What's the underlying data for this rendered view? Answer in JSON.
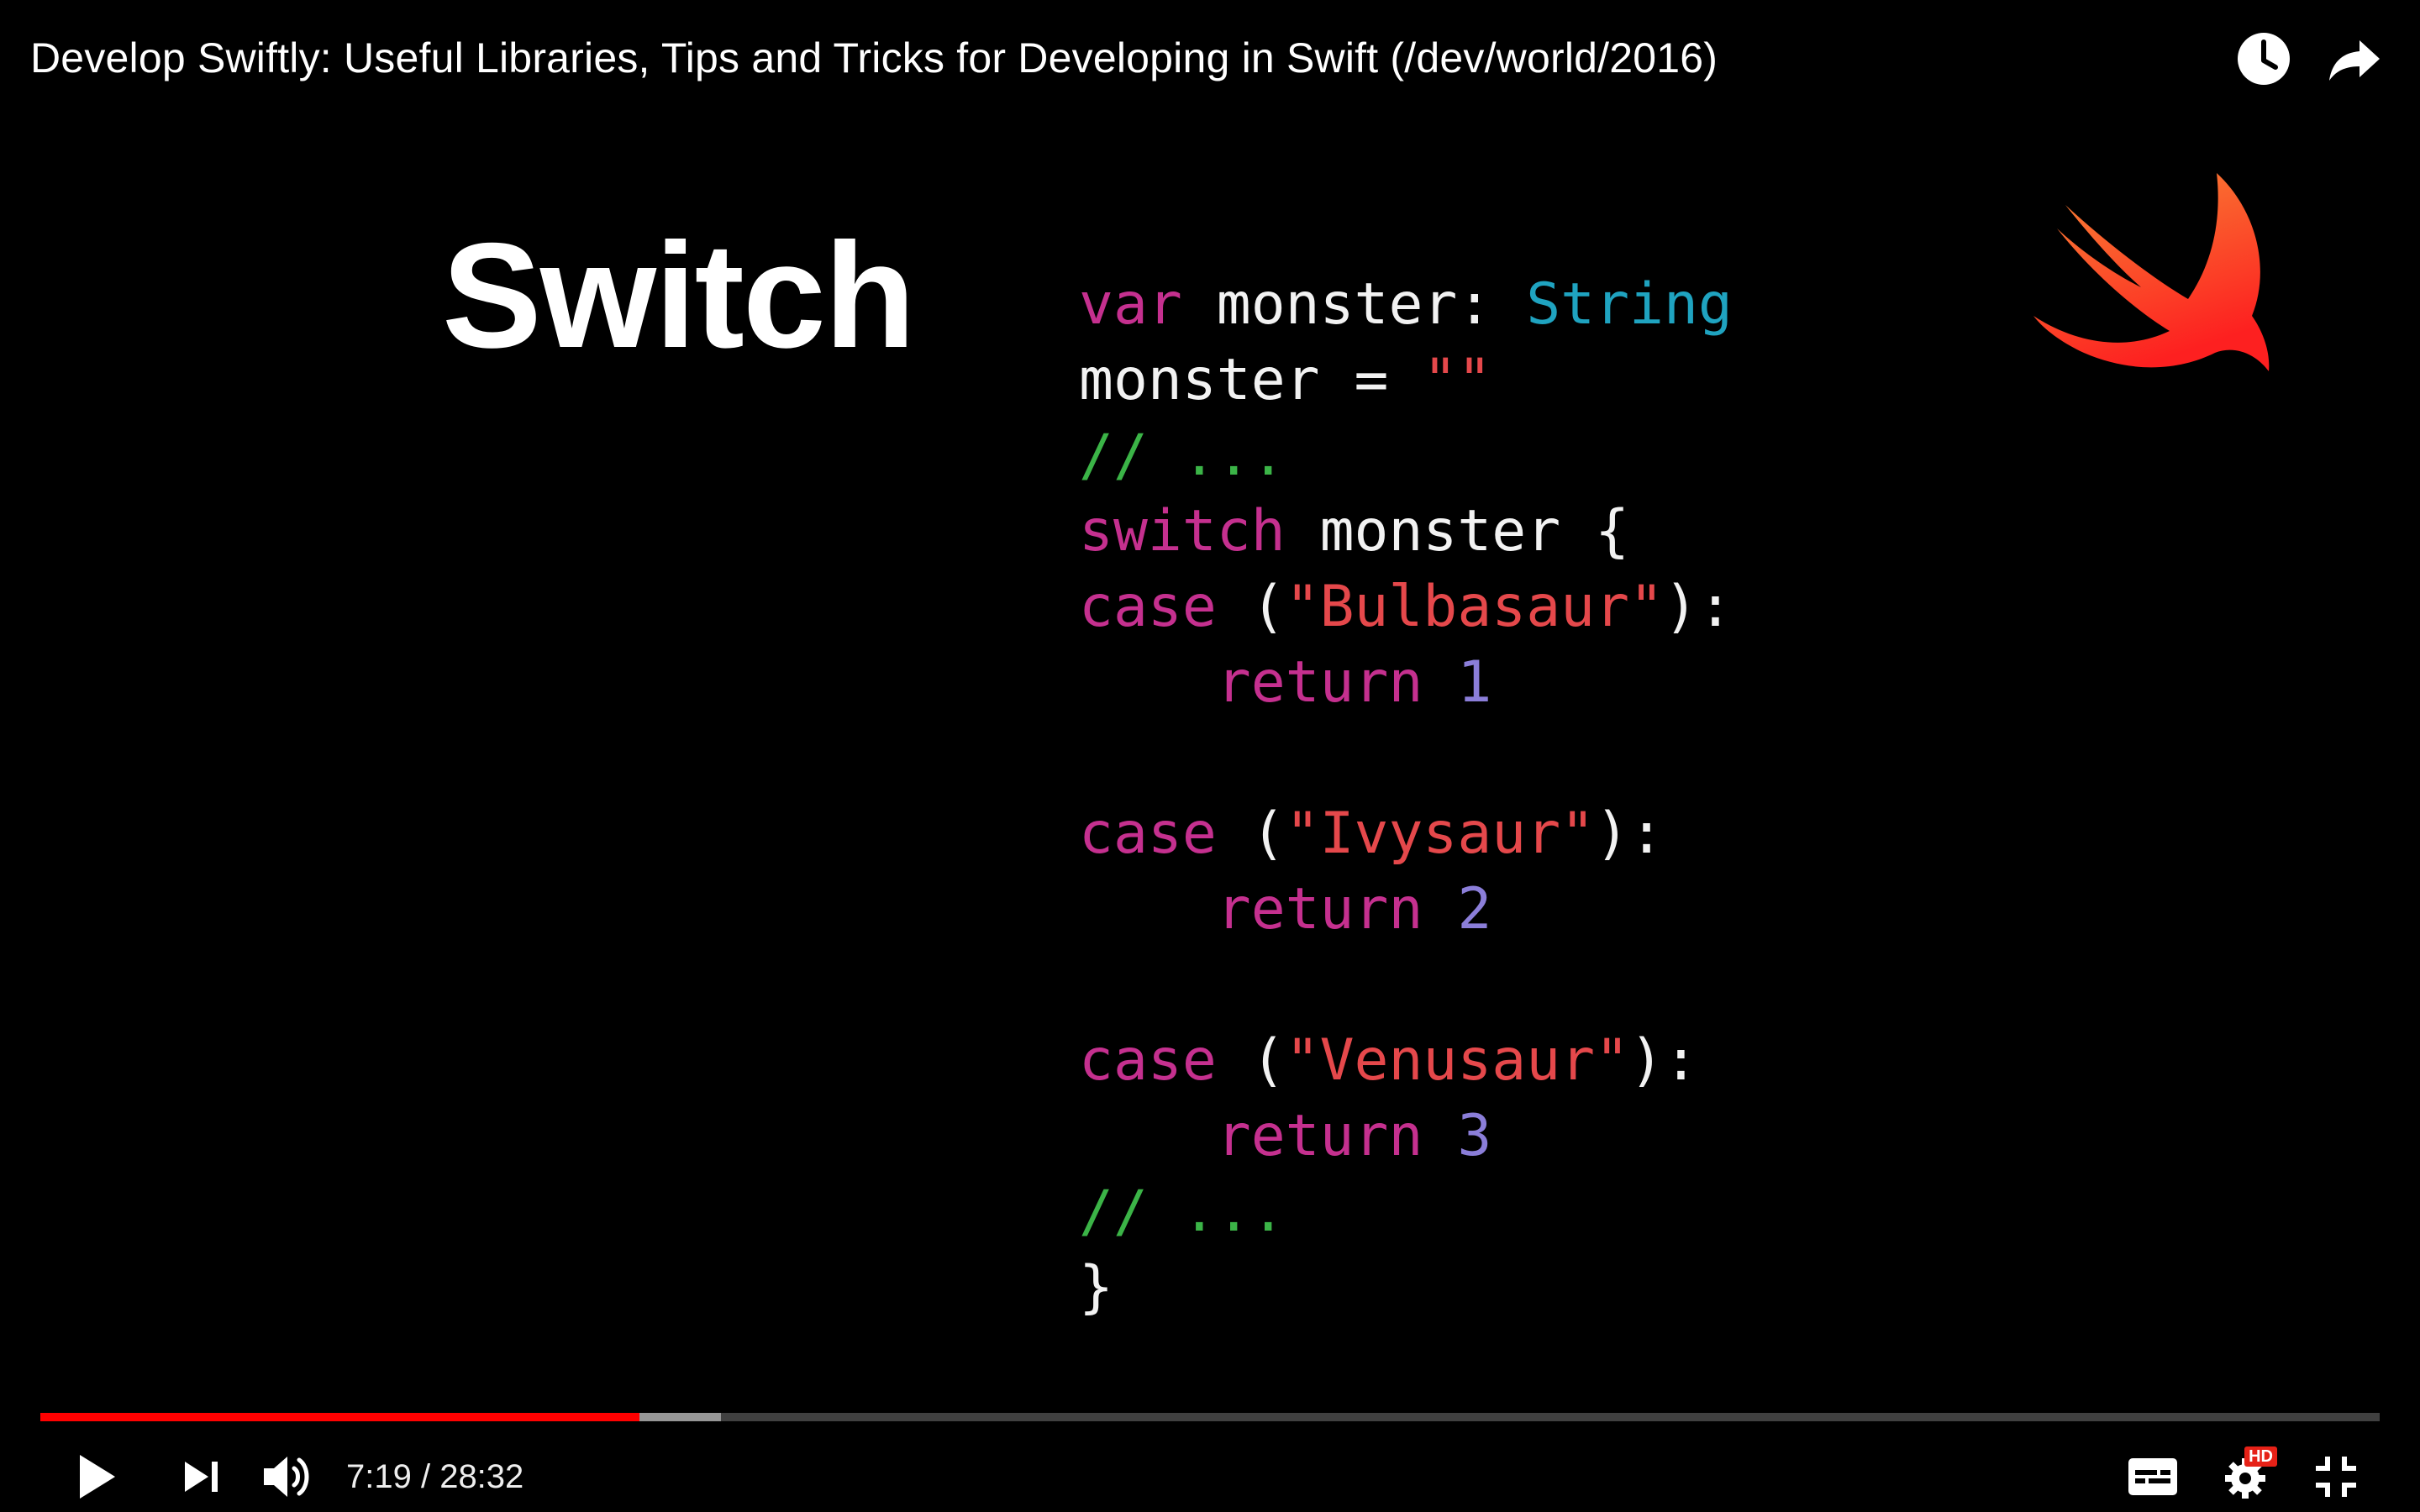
{
  "video": {
    "title": "Develop Swiftly: Useful Libraries, Tips and Tricks for Developing in Swift (/dev/world/2016)",
    "top_icons": [
      "watch-later-icon",
      "share-icon"
    ]
  },
  "slide": {
    "heading": "Switch",
    "logo": "swift-logo",
    "code_lines": [
      [
        {
          "t": "var",
          "c": "kw"
        },
        {
          "t": " monster: ",
          "c": "plain"
        },
        {
          "t": "String",
          "c": "type"
        }
      ],
      [
        {
          "t": "monster = ",
          "c": "plain"
        },
        {
          "t": "\"\"",
          "c": "str"
        }
      ],
      [
        {
          "t": "// ...",
          "c": "cmt"
        }
      ],
      [
        {
          "t": "switch",
          "c": "kw"
        },
        {
          "t": " monster {",
          "c": "plain"
        }
      ],
      [
        {
          "t": "case",
          "c": "kw"
        },
        {
          "t": " (",
          "c": "plain"
        },
        {
          "t": "\"Bulbasaur\"",
          "c": "str"
        },
        {
          "t": "):",
          "c": "plain"
        }
      ],
      [
        {
          "t": "    ",
          "c": "plain"
        },
        {
          "t": "return",
          "c": "kw"
        },
        {
          "t": " ",
          "c": "plain"
        },
        {
          "t": "1",
          "c": "num"
        }
      ],
      [],
      [
        {
          "t": "case",
          "c": "kw"
        },
        {
          "t": " (",
          "c": "plain"
        },
        {
          "t": "\"Ivysaur\"",
          "c": "str"
        },
        {
          "t": "):",
          "c": "plain"
        }
      ],
      [
        {
          "t": "    ",
          "c": "plain"
        },
        {
          "t": "return",
          "c": "kw"
        },
        {
          "t": " ",
          "c": "plain"
        },
        {
          "t": "2",
          "c": "num"
        }
      ],
      [],
      [
        {
          "t": "case",
          "c": "kw"
        },
        {
          "t": " (",
          "c": "plain"
        },
        {
          "t": "\"Venusaur\"",
          "c": "str"
        },
        {
          "t": "):",
          "c": "plain"
        }
      ],
      [
        {
          "t": "    ",
          "c": "plain"
        },
        {
          "t": "return",
          "c": "kw"
        },
        {
          "t": " ",
          "c": "plain"
        },
        {
          "t": "3",
          "c": "num"
        }
      ],
      [
        {
          "t": "// ...",
          "c": "cmt"
        }
      ],
      [
        {
          "t": "}",
          "c": "plain"
        }
      ]
    ]
  },
  "controls": {
    "current_time": "7:19",
    "duration": "28:32",
    "time_display": "7:19 / 28:32",
    "played_fraction": 0.256,
    "buffered_fraction": 0.291,
    "hd_badge": "HD",
    "icons": [
      "play-icon",
      "next-icon",
      "volume-icon",
      "subtitles-icon",
      "settings-icon",
      "exit-fullscreen-icon"
    ]
  },
  "colors": {
    "keyword": "#c5308f",
    "type": "#1fa3c0",
    "string": "#e5484b",
    "number": "#8b7ed9",
    "comment": "#3bb447",
    "progress_played": "#ff0000",
    "hd_badge": "#e62117"
  }
}
